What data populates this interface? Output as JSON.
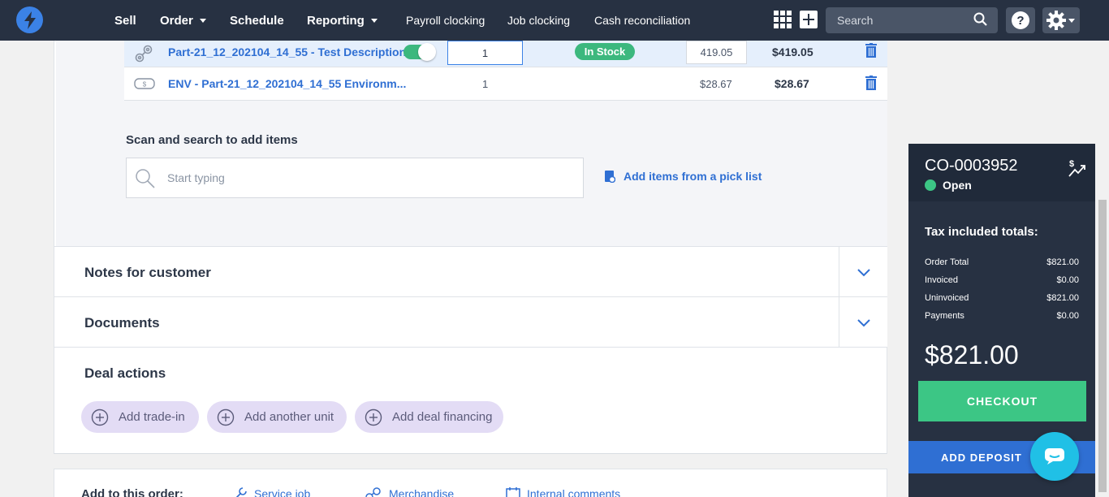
{
  "nav": {
    "items": [
      "Sell",
      "Order",
      "Schedule",
      "Reporting",
      "Payroll clocking",
      "Job clocking",
      "Cash reconciliation"
    ],
    "search_placeholder": "Search",
    "help_label": "?"
  },
  "line_items": [
    {
      "name": "Part-21_12_202104_14_55 - Test Description",
      "qty": "1",
      "stock": "In Stock",
      "price": "419.05",
      "total": "$419.05"
    },
    {
      "name": "ENV - Part-21_12_202104_14_55 Environm...",
      "qty": "1",
      "price": "$28.67",
      "total": "$28.67"
    }
  ],
  "scan": {
    "label": "Scan and search to add items",
    "placeholder": "Start typing",
    "picklist_link": "Add items from a pick list"
  },
  "sections": {
    "notes": "Notes for customer",
    "documents": "Documents"
  },
  "deal": {
    "title": "Deal actions",
    "buttons": [
      "Add trade-in",
      "Add another unit",
      "Add deal financing"
    ]
  },
  "add_to_order": {
    "label": "Add to this order:",
    "links": [
      "Service job",
      "Merchandise",
      "Internal comments"
    ]
  },
  "summary": {
    "order_number": "CO-0003952",
    "status": "Open",
    "tax_title": "Tax included totals:",
    "rows": [
      {
        "label": "Order Total",
        "value": "$821.00"
      },
      {
        "label": "Invoiced",
        "value": "$0.00"
      },
      {
        "label": "Uninvoiced",
        "value": "$821.00"
      },
      {
        "label": "Payments",
        "value": "$0.00"
      }
    ],
    "big_total": "$821.00",
    "checkout": "CHECKOUT",
    "deposit": "ADD DEPOSIT"
  },
  "colors": {
    "nav_bg": "#273142",
    "accent_blue": "#2f6fd3",
    "green": "#3cc685",
    "deal_button_bg": "#e3dcf5"
  }
}
